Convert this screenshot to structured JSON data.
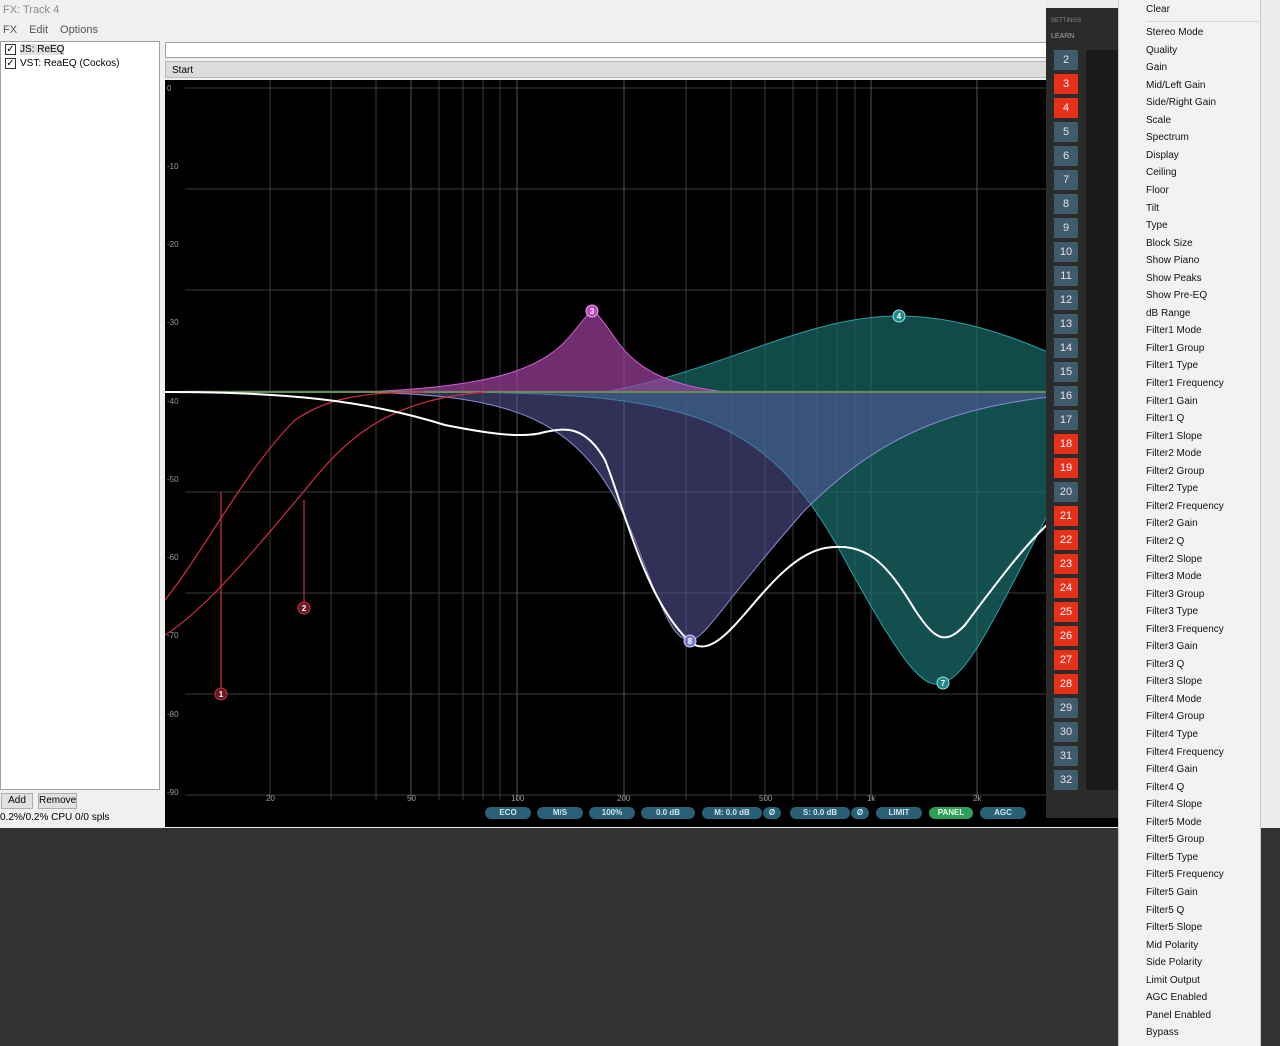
{
  "window": {
    "title": "FX: Track 4"
  },
  "menubar": [
    "FX",
    "Edit",
    "Options"
  ],
  "fx_chain": [
    {
      "label": "JS: ReEQ",
      "checked": true,
      "selected": true
    },
    {
      "label": "VST: ReaEQ (Cockos)",
      "checked": true,
      "selected": false
    }
  ],
  "buttons": {
    "add": "Add",
    "remove": "Remove"
  },
  "status": {
    "cpu": "0.2%/0.2% CPU 0/0 spls"
  },
  "preset": {
    "start_label": "Start"
  },
  "eq": {
    "y_ticks": [
      "0",
      "-10",
      "-20",
      "-30",
      "-40",
      "-50",
      "-60",
      "-70",
      "-80",
      "-90"
    ],
    "x_ticks": [
      "20",
      "50",
      "100",
      "200",
      "500",
      "1k",
      "2k"
    ],
    "bands": [
      {
        "id": "1",
        "color": "#e0404a"
      },
      {
        "id": "2",
        "color": "#e0404a"
      },
      {
        "id": "3",
        "color": "#c048c0"
      },
      {
        "id": "4",
        "color": "#2a9a9a"
      },
      {
        "id": "7",
        "color": "#2a9a9a"
      },
      {
        "id": "8",
        "color": "#8a7ad0"
      }
    ],
    "toolbar": [
      {
        "label": "ECO",
        "active": false
      },
      {
        "label": "M/S",
        "active": false
      },
      {
        "label": "100%",
        "active": false
      },
      {
        "label": "0.0 dB",
        "active": false
      },
      {
        "label": "M: 0.0 dB",
        "active": false
      },
      {
        "label": "Ø",
        "active": false
      },
      {
        "label": "S: 0.0 dB",
        "active": false
      },
      {
        "label": "Ø",
        "active": false
      },
      {
        "label": "LIMIT",
        "active": false
      },
      {
        "label": "PANEL",
        "active": true
      },
      {
        "label": "AGC",
        "active": false
      }
    ]
  },
  "learn_panel": {
    "settings_tab": "SETTINGS",
    "learn_tab": "LEARN",
    "numbers": [
      {
        "n": "2",
        "red": false
      },
      {
        "n": "3",
        "red": true
      },
      {
        "n": "4",
        "red": true
      },
      {
        "n": "5",
        "red": false
      },
      {
        "n": "6",
        "red": false
      },
      {
        "n": "7",
        "red": false
      },
      {
        "n": "8",
        "red": false
      },
      {
        "n": "9",
        "red": false
      },
      {
        "n": "10",
        "red": false
      },
      {
        "n": "11",
        "red": false
      },
      {
        "n": "12",
        "red": false
      },
      {
        "n": "13",
        "red": false
      },
      {
        "n": "14",
        "red": false
      },
      {
        "n": "15",
        "red": false
      },
      {
        "n": "16",
        "red": false
      },
      {
        "n": "17",
        "red": false
      },
      {
        "n": "18",
        "red": true
      },
      {
        "n": "19",
        "red": true
      },
      {
        "n": "20",
        "red": false
      },
      {
        "n": "21",
        "red": true
      },
      {
        "n": "22",
        "red": true
      },
      {
        "n": "23",
        "red": true
      },
      {
        "n": "24",
        "red": true
      },
      {
        "n": "25",
        "red": true
      },
      {
        "n": "26",
        "red": true
      },
      {
        "n": "27",
        "red": true
      },
      {
        "n": "28",
        "red": true
      },
      {
        "n": "29",
        "red": false
      },
      {
        "n": "30",
        "red": false
      },
      {
        "n": "31",
        "red": false
      },
      {
        "n": "32",
        "red": false
      }
    ]
  },
  "context_menu": {
    "first": "Clear",
    "items": [
      "Stereo Mode",
      "Quality",
      "Gain",
      "Mid/Left Gain",
      "Side/Right Gain",
      "Scale",
      "Spectrum",
      "Display",
      "Ceiling",
      "Floor",
      "Tilt",
      "Type",
      "Block Size",
      "Show Piano",
      "Show Peaks",
      "Show Pre-EQ",
      "dB Range",
      "Filter1 Mode",
      "Filter1 Group",
      "Filter1 Type",
      "Filter1 Frequency",
      "Filter1 Gain",
      "Filter1 Q",
      "Filter1 Slope",
      "Filter2 Mode",
      "Filter2 Group",
      "Filter2 Type",
      "Filter2 Frequency",
      "Filter2 Gain",
      "Filter2 Q",
      "Filter2 Slope",
      "Filter3 Mode",
      "Filter3 Group",
      "Filter3 Type",
      "Filter3 Frequency",
      "Filter3 Gain",
      "Filter3 Q",
      "Filter3 Slope",
      "Filter4 Mode",
      "Filter4 Group",
      "Filter4 Type",
      "Filter4 Frequency",
      "Filter4 Gain",
      "Filter4 Q",
      "Filter4 Slope",
      "Filter5 Mode",
      "Filter5 Group",
      "Filter5 Type",
      "Filter5 Frequency",
      "Filter5 Gain",
      "Filter5 Q",
      "Filter5 Slope",
      "Mid Polarity",
      "Side Polarity",
      "Limit Output",
      "AGC Enabled",
      "Panel Enabled",
      "Bypass"
    ]
  }
}
